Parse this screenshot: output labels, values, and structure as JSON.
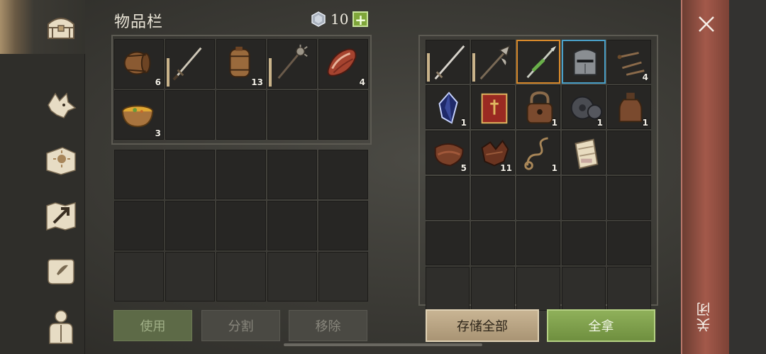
{
  "header": {
    "title": "物品栏",
    "currency_value": "10",
    "add_label": "+"
  },
  "sidebar": {
    "items": [
      {
        "name": "storage-chest-icon"
      },
      {
        "name": "wolf-head-icon"
      },
      {
        "name": "sun-book-icon"
      },
      {
        "name": "map-arrow-icon"
      },
      {
        "name": "quest-scroll-icon"
      },
      {
        "name": "character-icon"
      }
    ]
  },
  "left_inventory": {
    "cells": [
      {
        "icon": "barrel-icon",
        "qty": "6"
      },
      {
        "icon": "sword-icon",
        "qty": "",
        "durability": true
      },
      {
        "icon": "keg-icon",
        "qty": "13"
      },
      {
        "icon": "mace-icon",
        "qty": "",
        "durability": true
      },
      {
        "icon": "meat-icon",
        "qty": "4"
      },
      {
        "icon": "soup-bowl-icon",
        "qty": "3"
      }
    ]
  },
  "right_storage": {
    "cells": [
      {
        "icon": "longsword-icon",
        "qty": "",
        "durability": true
      },
      {
        "icon": "halberd-icon",
        "qty": "",
        "durability": true
      },
      {
        "icon": "green-spear-icon",
        "qty": "",
        "rarity": "orange"
      },
      {
        "icon": "knight-helmet-icon",
        "qty": "",
        "rarity": "blue"
      },
      {
        "icon": "nails-icon",
        "qty": "4"
      },
      {
        "icon": "crystal-icon",
        "qty": "1"
      },
      {
        "icon": "red-book-icon",
        "qty": ""
      },
      {
        "icon": "padlock-icon",
        "qty": "1"
      },
      {
        "icon": "gear-icon",
        "qty": "1"
      },
      {
        "icon": "bottle-icon",
        "qty": "1"
      },
      {
        "icon": "leather-icon",
        "qty": "5"
      },
      {
        "icon": "scraps-icon",
        "qty": "11"
      },
      {
        "icon": "rope-icon",
        "qty": "1"
      },
      {
        "icon": "parchment-roll-icon",
        "qty": ""
      }
    ]
  },
  "buttons": {
    "use": "使用",
    "split": "分割",
    "remove": "移除",
    "store_all": "存储全部",
    "take_all": "全拿",
    "close": "关闭"
  },
  "colors": {
    "take_all": "#7fa04a",
    "store_all": "#b9a482",
    "close_bar": "#9a5546",
    "rarity_orange": "#d98a2b",
    "rarity_blue": "#4aa0c8"
  }
}
